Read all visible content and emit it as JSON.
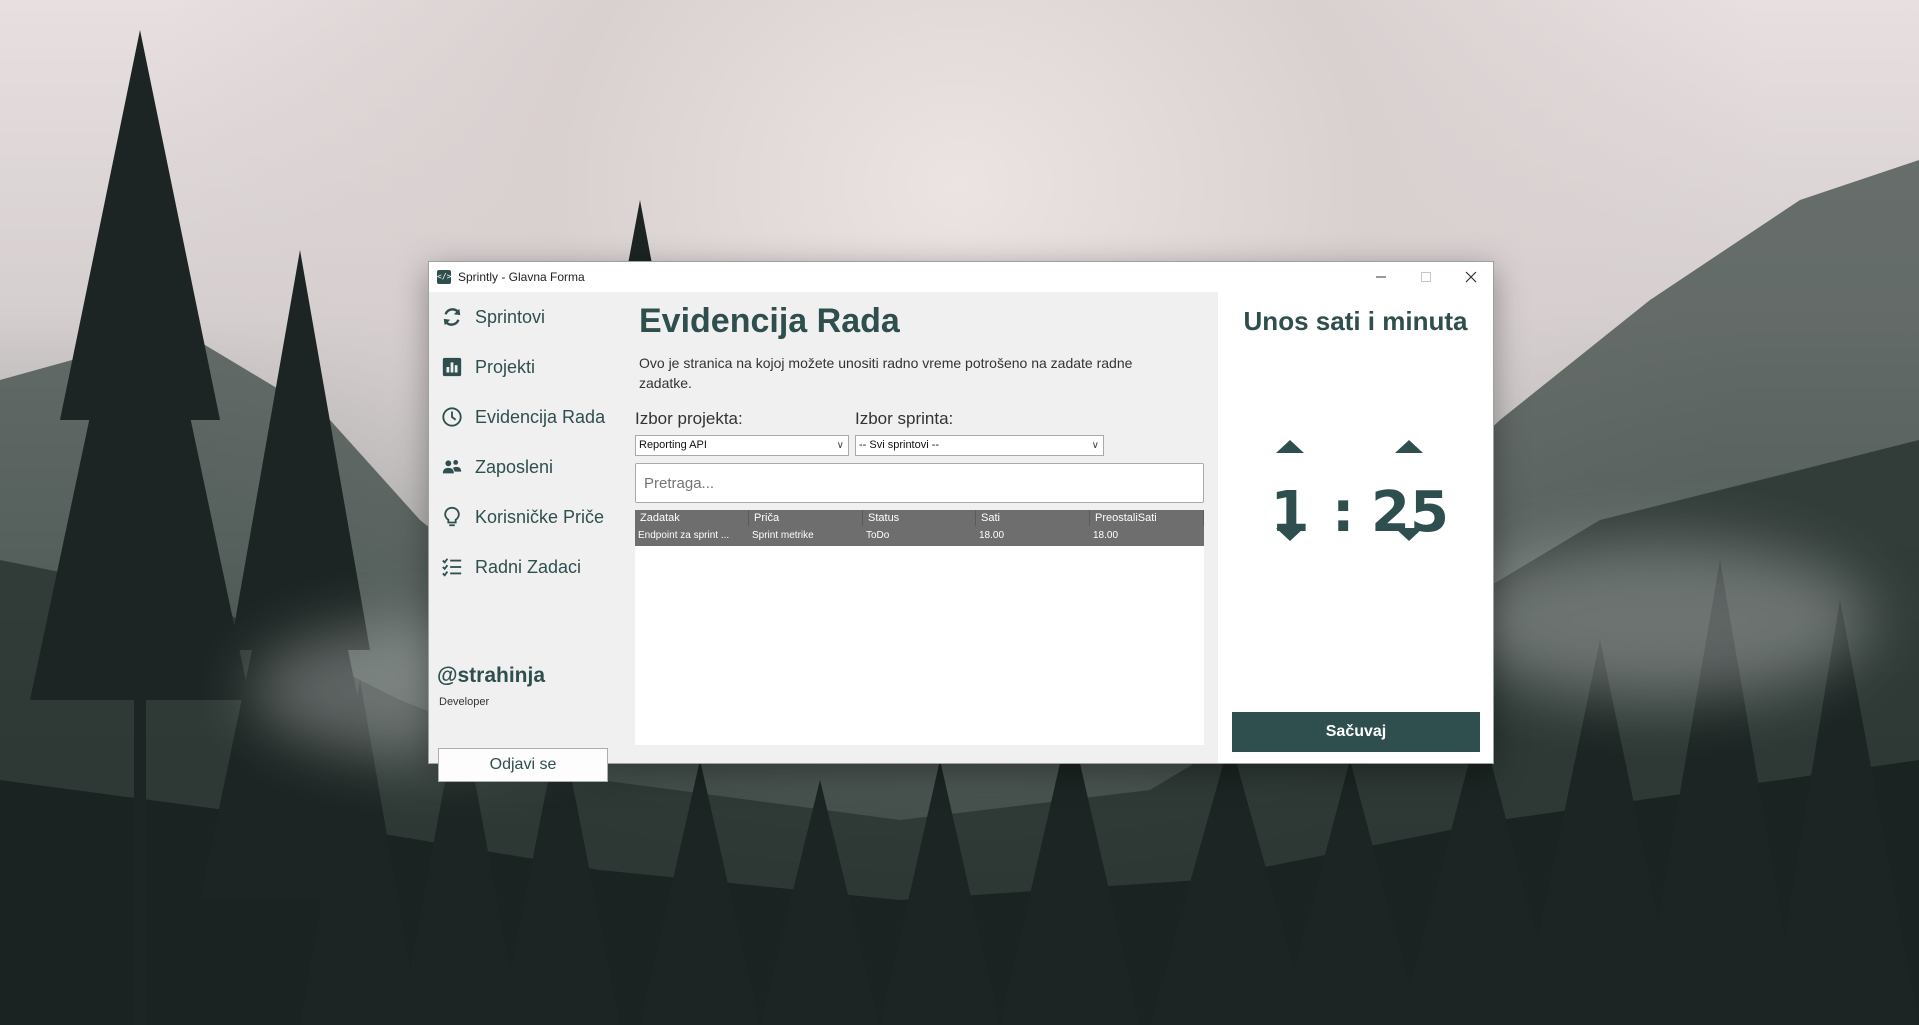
{
  "window": {
    "title": "Sprintly - Glavna Forma",
    "app_icon": "code-icon"
  },
  "sidebar": {
    "items": [
      {
        "label": "Sprintovi",
        "icon": "refresh-icon"
      },
      {
        "label": "Projekti",
        "icon": "bar-chart-icon"
      },
      {
        "label": "Evidencija Rada",
        "icon": "clock-icon"
      },
      {
        "label": "Zaposleni",
        "icon": "users-icon"
      },
      {
        "label": "Korisničke Priče",
        "icon": "lightbulb-icon"
      },
      {
        "label": "Radni Zadaci",
        "icon": "checklist-icon"
      }
    ],
    "user": {
      "name": "@strahinja",
      "role": "Developer"
    },
    "logout_label": "Odjavi se"
  },
  "main": {
    "title": "Evidencija Rada",
    "description": "Ovo je stranica na kojoj možete unositi radno vreme potrošeno na zadate radne zadatke.",
    "project_label": "Izbor projekta:",
    "project_value": "Reporting API",
    "sprint_label": "Izbor sprinta:",
    "sprint_value": "-- Svi sprintovi --",
    "search_placeholder": "Pretraga...",
    "table": {
      "columns": [
        "Zadatak",
        "Priča",
        "Status",
        "Sati",
        "PreostaliSati"
      ],
      "rows": [
        [
          "Endpoint za sprint ...",
          "Sprint metrike",
          "ToDo",
          "18.00",
          "18.00"
        ]
      ]
    }
  },
  "time_entry": {
    "title": "Unos sati i minuta",
    "hours": "1",
    "separator": ":",
    "minutes": "25",
    "save_label": "Sačuvaj"
  },
  "colors": {
    "accent": "#2f4f4f",
    "panel": "#f0f0f0",
    "grid_row": "#6e6e6e"
  }
}
